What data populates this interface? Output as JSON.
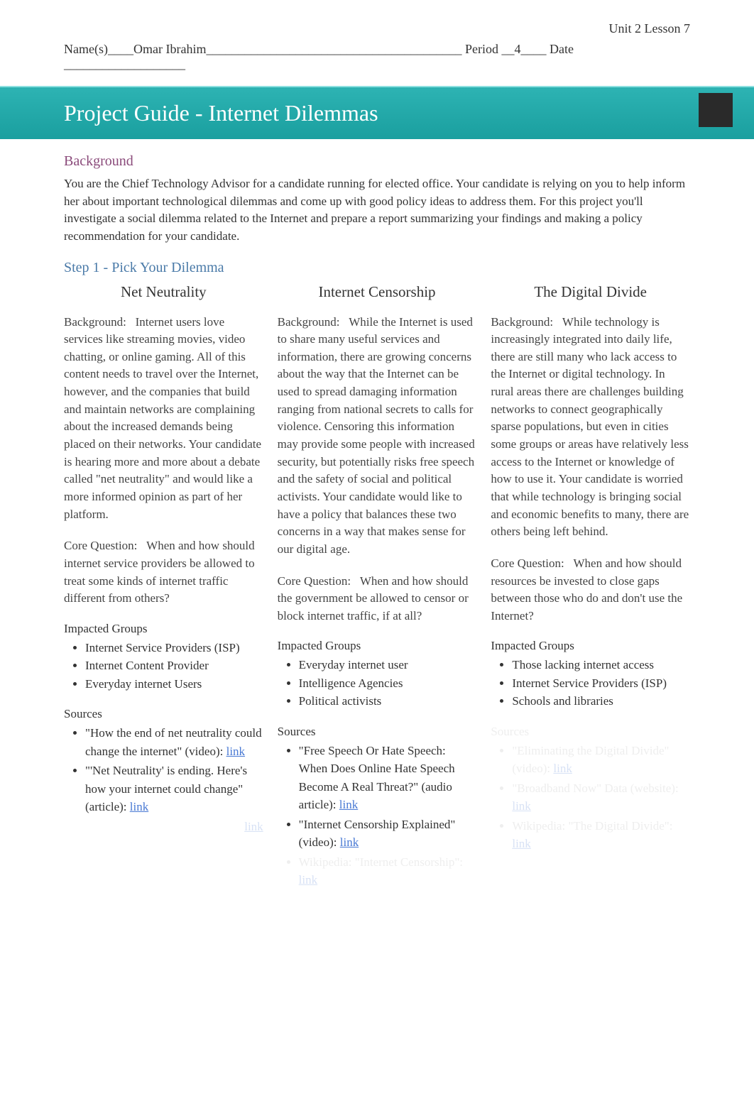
{
  "header": {
    "unit_label": "Unit 2 Lesson 7",
    "name_prefix": "Name(s)____",
    "name_value": "Omar Ibrahim",
    "name_suffix": "________________________________________ Period __",
    "period_value": "4",
    "period_suffix": "____ Date ___________________"
  },
  "title": "Project Guide - Internet Dilemmas",
  "background": {
    "heading": "Background",
    "text": "You are the Chief Technology Advisor for a candidate running for elected office. Your candidate is relying on you to help inform her about important technological dilemmas and come up with good policy ideas to address them. For this project you'll investigate a social dilemma related to the Internet and prepare a report summarizing your findings and making a policy recommendation for your candidate."
  },
  "step1": {
    "heading": "Step 1 - Pick Your Dilemma"
  },
  "columns": [
    {
      "title": "Net Neutrality",
      "bg_label": "Background:",
      "bg_text": "Internet users love services like streaming movies, video chatting, or online gaming. All of this content needs to travel over the Internet, however, and the companies that build and maintain networks are complaining about the increased demands being placed on their networks. Your candidate is hearing more and more about a debate called \"net neutrality\" and would like a more informed opinion as part of her platform.",
      "cq_label": "Core Question:",
      "cq_text": "When and how should internet service providers be allowed to treat some kinds of internet traffic different from others?",
      "impacted_heading": "Impacted Groups",
      "impacted": [
        "Internet Service Providers (ISP)",
        "Internet Content Provider",
        "Everyday internet Users"
      ],
      "sources_heading": "Sources",
      "sources_faded": false,
      "sources": [
        {
          "text": "\"How the end of net neutrality could change the internet\" (video): ",
          "link": "link",
          "faded": false
        },
        {
          "text": "\"'Net Neutrality' is ending. Here's how your internet could change\" (article): ",
          "link": "link",
          "faded": false
        },
        {
          "text": "",
          "link": "link",
          "faded": true,
          "leading_faded": true
        }
      ]
    },
    {
      "title": "Internet Censorship",
      "bg_label": "Background:",
      "bg_text": "While the Internet is used to share many useful services and information, there are growing concerns about the way that the Internet can be used to spread damaging information ranging from national secrets to calls for violence. Censoring this information may provide some people with increased security, but potentially risks free speech and the safety of social and political activists. Your candidate would like to have a policy that balances these two concerns in a way that makes sense for our digital age.",
      "cq_label": "Core Question:",
      "cq_text": "When and how should the government be allowed to censor or block internet traffic, if at all?",
      "impacted_heading": "Impacted Groups",
      "impacted": [
        "Everyday internet user",
        "Intelligence Agencies",
        "Political activists"
      ],
      "sources_heading": "Sources",
      "sources_faded": false,
      "sources": [
        {
          "text": "\"Free Speech Or Hate Speech: When Does Online Hate Speech Become A Real Threat?\" (audio article): ",
          "link": "link",
          "faded": false
        },
        {
          "text": "\"Internet Censorship Explained\" (video): ",
          "link": "link",
          "faded": false
        },
        {
          "text": "Wikipedia: \"Internet Censorship\": ",
          "link": "link",
          "faded": true
        }
      ]
    },
    {
      "title": "The Digital Divide",
      "bg_label": "Background:",
      "bg_text": "While technology is increasingly integrated into daily life, there are still many who lack access to the Internet or digital technology. In rural areas there are challenges building networks to connect geographically sparse populations, but even in cities some groups or areas have relatively less access to the Internet or knowledge of how to use it. Your candidate is worried that while technology is bringing social and economic benefits to many, there are others being left behind.",
      "cq_label": "Core Question:",
      "cq_text": "When and how should resources be invested to close gaps between those who do and don't use the Internet?",
      "impacted_heading": "Impacted Groups",
      "impacted": [
        "Those lacking internet access",
        "Internet Service Providers (ISP)",
        "Schools and libraries"
      ],
      "sources_heading": "Sources",
      "sources_faded": true,
      "sources": [
        {
          "text": "\"Eliminating the Digital Divide\" (video): ",
          "link": "link",
          "faded": true
        },
        {
          "text": "\"Broadband Now\" Data (website): ",
          "link": "link",
          "faded": true
        },
        {
          "text": "Wikipedia: \"The Digital Divide\": ",
          "link": "link",
          "faded": true
        }
      ]
    }
  ]
}
